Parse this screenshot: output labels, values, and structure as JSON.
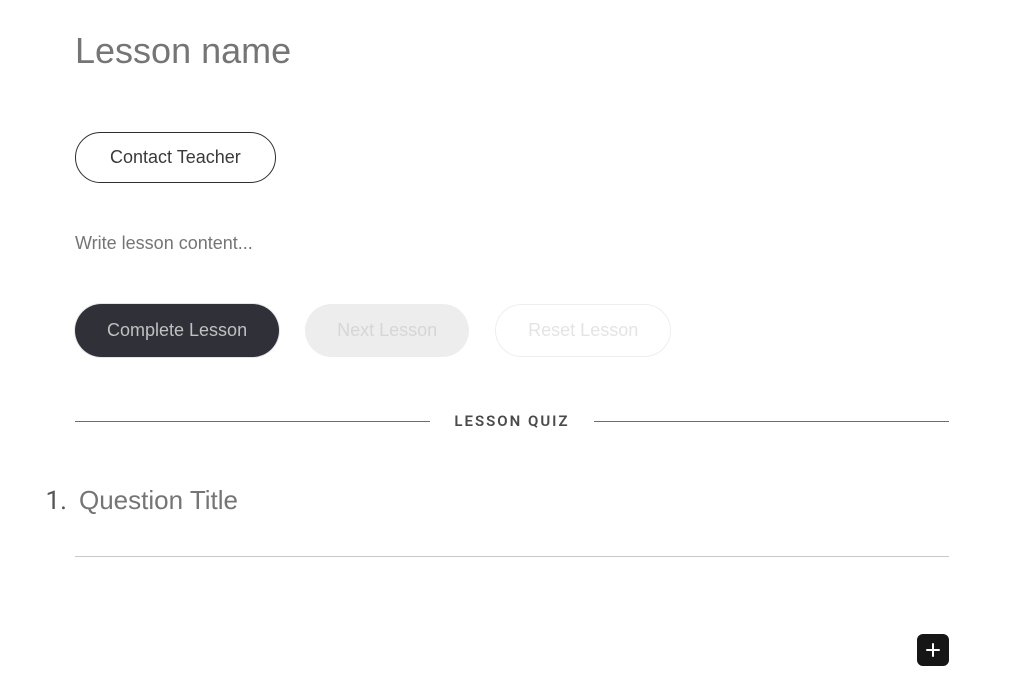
{
  "lesson": {
    "title_placeholder": "Lesson name",
    "content_placeholder": "Write lesson content..."
  },
  "buttons": {
    "contact_teacher": "Contact Teacher",
    "complete_lesson": "Complete Lesson",
    "next_lesson": "Next Lesson",
    "reset_lesson": "Reset Lesson"
  },
  "divider": {
    "label": "LESSON QUIZ"
  },
  "quiz": {
    "questions": [
      {
        "number": "1.",
        "title_placeholder": "Question Title"
      }
    ]
  }
}
